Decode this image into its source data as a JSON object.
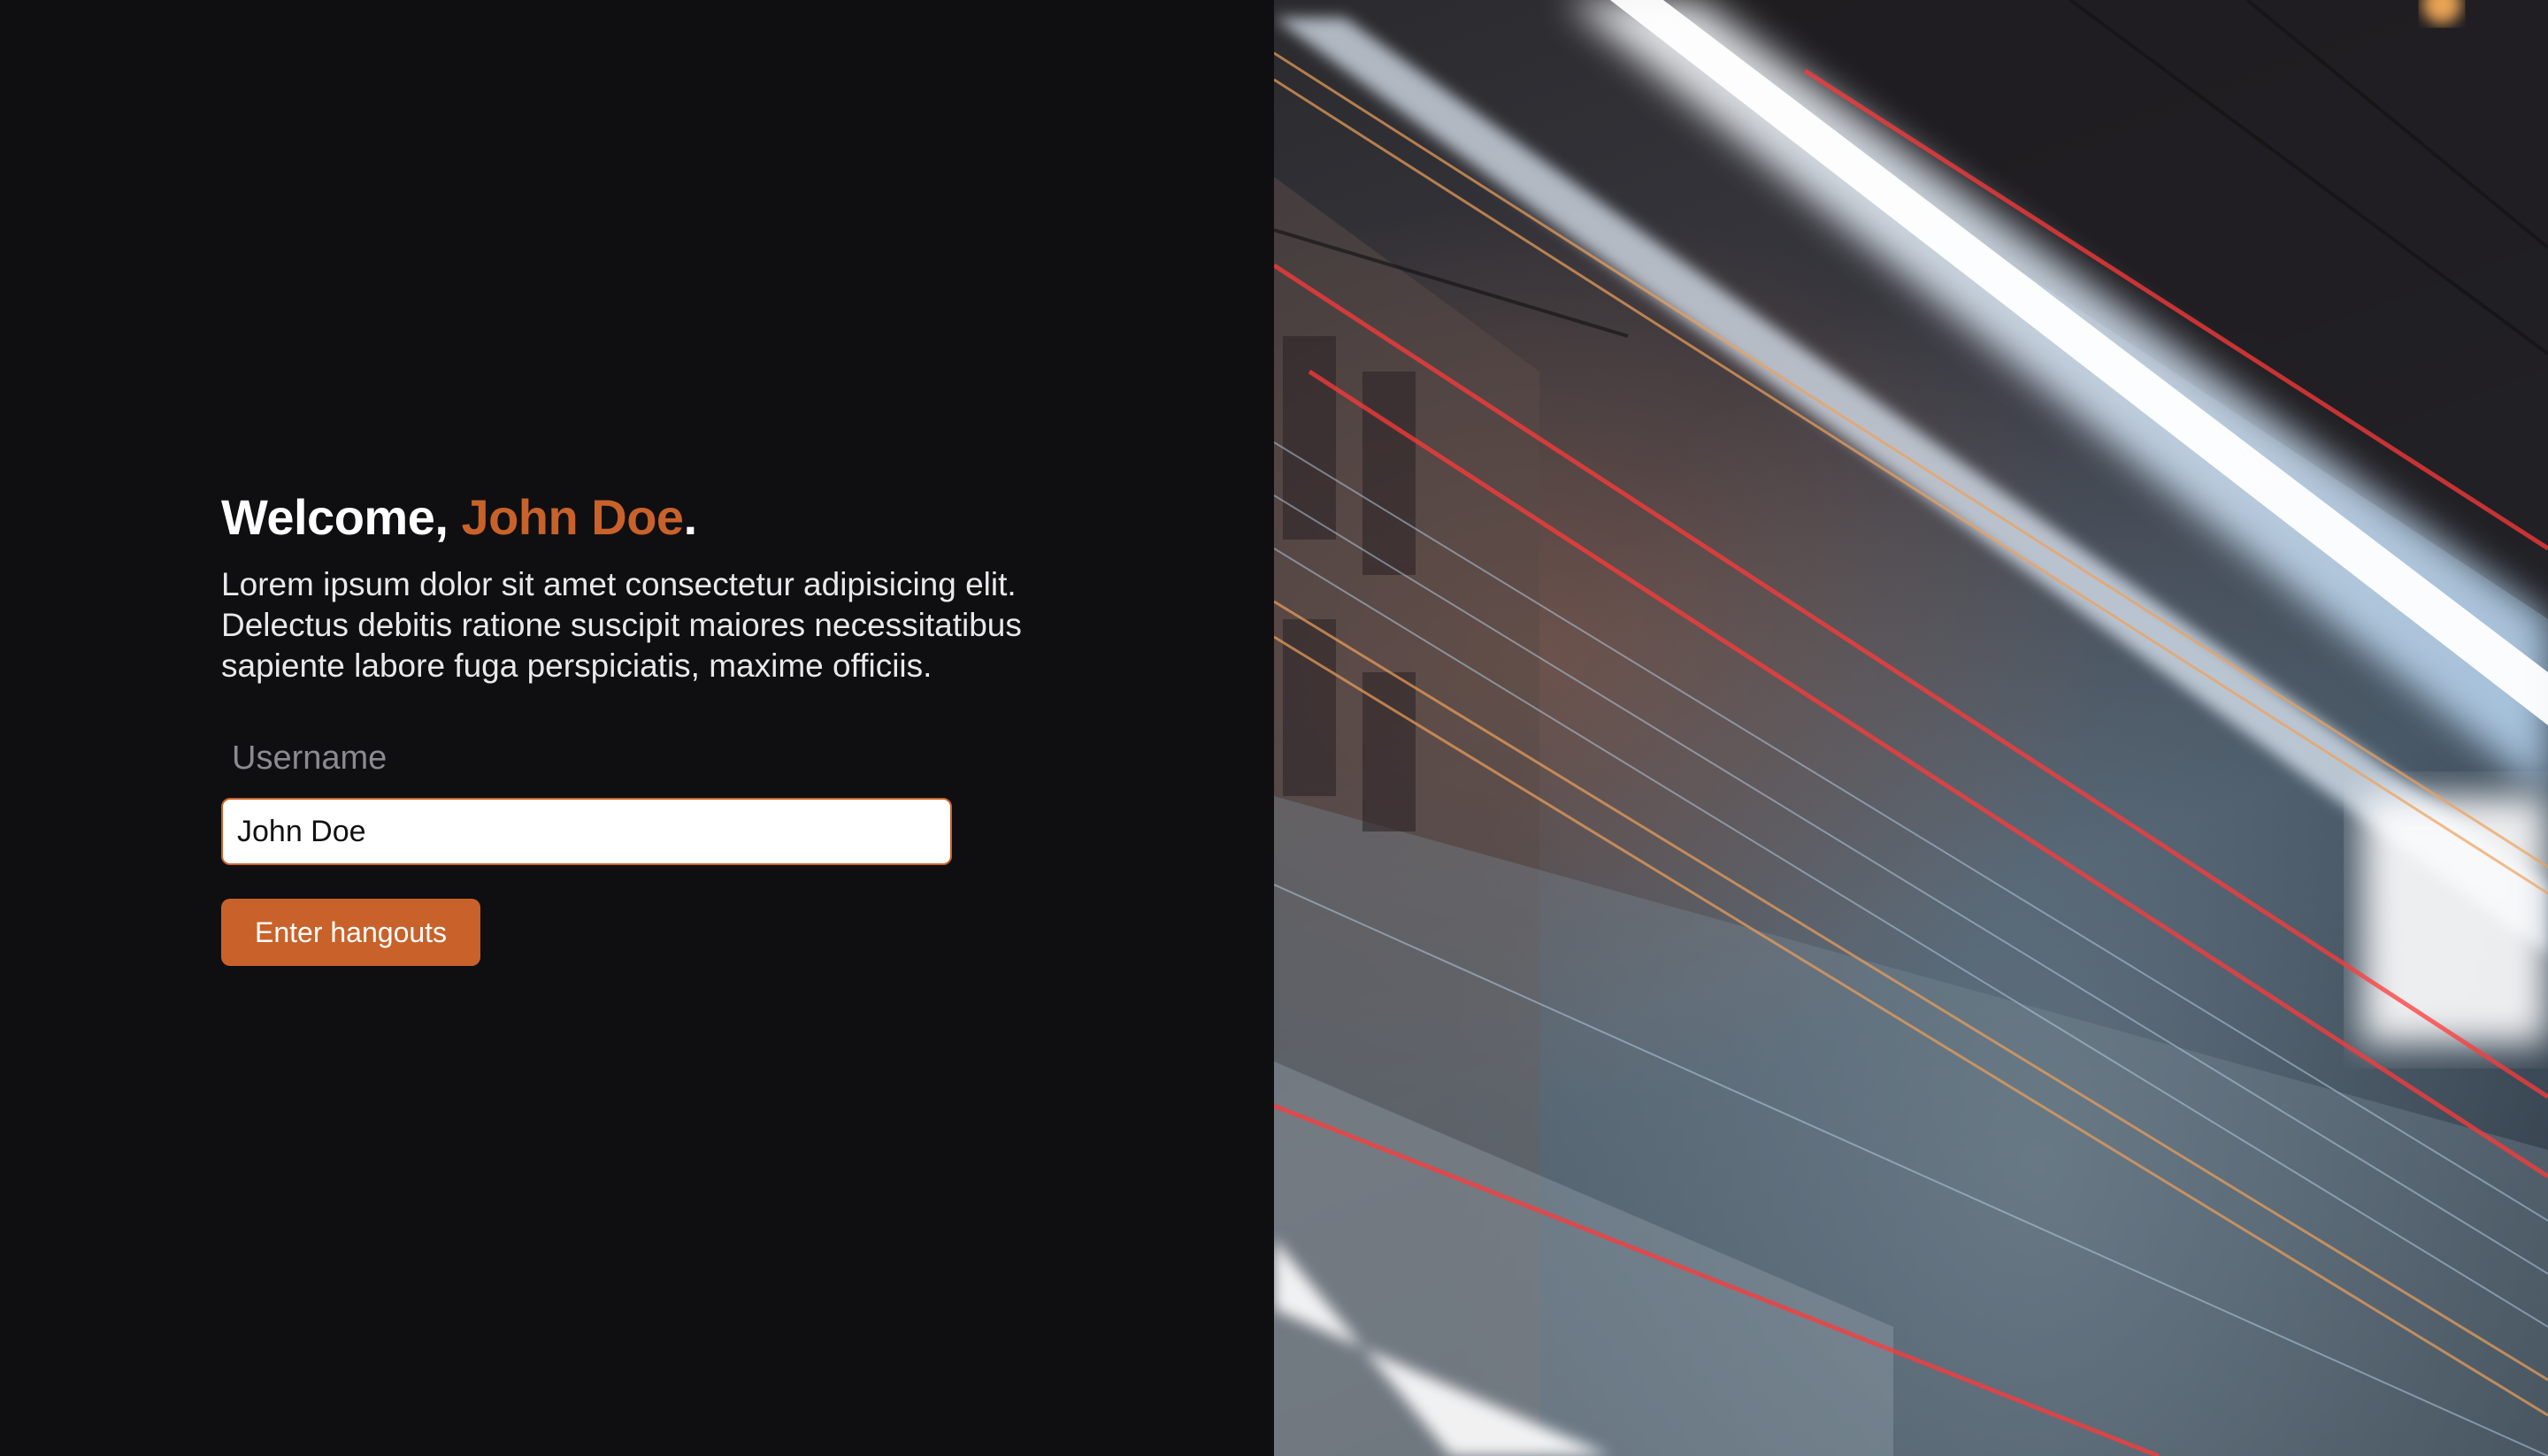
{
  "welcome": {
    "prefix": "Welcome, ",
    "name": "John Doe",
    "suffix": "."
  },
  "intro": {
    "text": "Lorem ipsum dolor sit amet consectetur adipisicing elit. Delectus debitis ratione suscipit maiores necessitatibus sapiente labore fuga perspiciatis, maxime officiis."
  },
  "form": {
    "username_label": "Username",
    "username_value": "John Doe",
    "submit_label": "Enter hangouts"
  },
  "colors": {
    "accent": "#c8622a",
    "background": "#0f0f11",
    "text": "#ffffff"
  }
}
